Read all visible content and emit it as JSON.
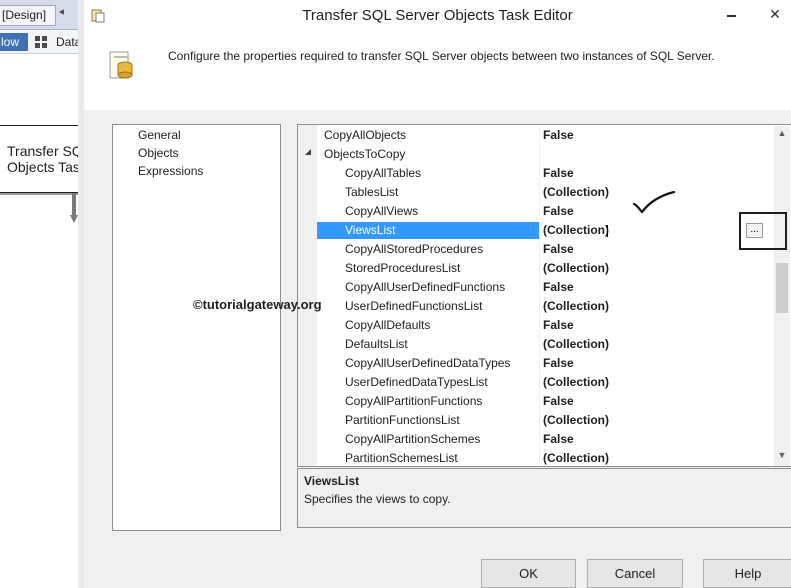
{
  "background": {
    "design_tab": "[Design]",
    "flow_tab": "low",
    "data_tab": "Data",
    "task_label": "Transfer SQL\nObjects Task"
  },
  "dialog": {
    "title": "Transfer SQL Server Objects Task Editor",
    "close_icon": "✕",
    "description": "Configure the properties required to transfer SQL Server objects between two instances of SQL Server."
  },
  "nav": {
    "items": [
      "General",
      "Objects",
      "Expressions"
    ]
  },
  "grid": {
    "rows": [
      {
        "name": "CopyAllObjects",
        "value": "False",
        "indent": 0
      },
      {
        "name": "ObjectsToCopy",
        "value": "",
        "indent": 0,
        "expanded": true
      },
      {
        "name": "CopyAllTables",
        "value": "False",
        "indent": 1
      },
      {
        "name": "TablesList",
        "value": "(Collection)",
        "indent": 1
      },
      {
        "name": "CopyAllViews",
        "value": "False",
        "indent": 1
      },
      {
        "name": "ViewsList",
        "value": "(Collection)",
        "indent": 1,
        "selected": true
      },
      {
        "name": "CopyAllStoredProcedures",
        "value": "False",
        "indent": 1
      },
      {
        "name": "StoredProceduresList",
        "value": "(Collection)",
        "indent": 1
      },
      {
        "name": "CopyAllUserDefinedFunctions",
        "value": "False",
        "indent": 1
      },
      {
        "name": "UserDefinedFunctionsList",
        "value": "(Collection)",
        "indent": 1
      },
      {
        "name": "CopyAllDefaults",
        "value": "False",
        "indent": 1
      },
      {
        "name": "DefaultsList",
        "value": "(Collection)",
        "indent": 1
      },
      {
        "name": "CopyAllUserDefinedDataTypes",
        "value": "False",
        "indent": 1
      },
      {
        "name": "UserDefinedDataTypesList",
        "value": "(Collection)",
        "indent": 1
      },
      {
        "name": "CopyAllPartitionFunctions",
        "value": "False",
        "indent": 1
      },
      {
        "name": "PartitionFunctionsList",
        "value": "(Collection)",
        "indent": 1
      },
      {
        "name": "CopyAllPartitionSchemes",
        "value": "False",
        "indent": 1
      },
      {
        "name": "PartitionSchemesList",
        "value": "(Collection)",
        "indent": 1
      }
    ],
    "ellipsis_label": "...",
    "scroll_up": "▲",
    "scroll_down": "▼"
  },
  "description_pane": {
    "title": "ViewsList",
    "text": "Specifies the views to copy."
  },
  "watermark": "©tutorialgateway.org",
  "buttons": {
    "ok": "OK",
    "cancel": "Cancel",
    "help": "Help"
  },
  "colors": {
    "selection": "#3399ff",
    "dialog_bg": "#f0f0f0",
    "flow_tab": "#3f6fb5"
  }
}
